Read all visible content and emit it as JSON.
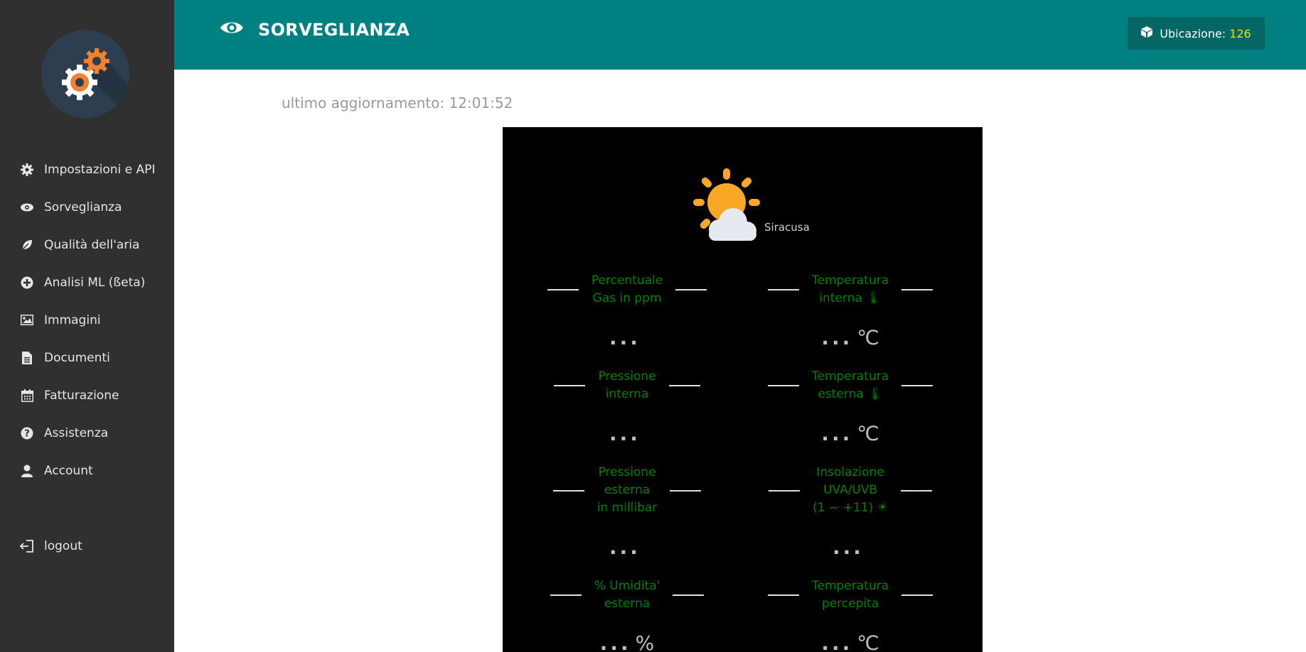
{
  "sidebar": {
    "items": [
      {
        "label": "Impostazioni e API",
        "icon": "gear-icon"
      },
      {
        "label": "Sorveglianza",
        "icon": "eye-icon"
      },
      {
        "label": "Qualità dell'aria",
        "icon": "leaf-icon"
      },
      {
        "label": "Analisi ML (ßeta)",
        "icon": "plus-circle-icon"
      },
      {
        "label": "Immagini",
        "icon": "image-icon"
      },
      {
        "label": "Documenti",
        "icon": "document-icon"
      },
      {
        "label": "Fatturazione",
        "icon": "calendar-icon"
      },
      {
        "label": "Assistenza",
        "icon": "question-icon"
      },
      {
        "label": "Account",
        "icon": "user-icon"
      }
    ],
    "logout_label": "logout"
  },
  "header": {
    "title": "SORVEGLIANZA",
    "location_label": "Ubicazione:",
    "location_value": "126"
  },
  "main": {
    "updated_text": "ultimo aggiornamento: 12:01:52",
    "city": "Siracusa",
    "metrics": [
      {
        "label": "Percentuale\nGas in ppm",
        "value": "...",
        "unit": ""
      },
      {
        "label": "Temperatura\ninterna 🌡",
        "value": "...",
        "unit": "℃"
      },
      {
        "label": "Pressione\ninterna",
        "value": "...",
        "unit": ""
      },
      {
        "label": "Temperatura\nesterna 🌡",
        "value": "...",
        "unit": "℃"
      },
      {
        "label": "Pressione\nesterna\nin millibar",
        "value": "...",
        "unit": ""
      },
      {
        "label": "Insolazione\nUVA/UVB\n(1 ~ +11) ☀",
        "value": "...",
        "unit": ""
      },
      {
        "label": "% Umidita'\nesterna",
        "value": "...",
        "unit": "%"
      },
      {
        "label": "Temperatura\npercepita",
        "value": "...",
        "unit": "℃"
      }
    ]
  },
  "colors": {
    "header_bg": "#008080",
    "sidebar_bg": "#303030",
    "metric_label": "#008000",
    "location_value": "#e6e600"
  }
}
